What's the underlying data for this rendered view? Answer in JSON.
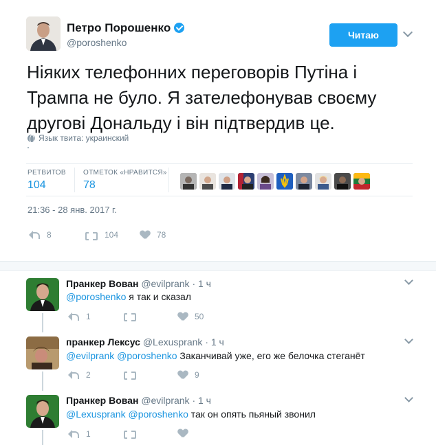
{
  "tweet": {
    "author_name": "Петро Порошенко",
    "author_handle": "@poroshenko",
    "follow_label": "Читаю",
    "text": "Ніяких телефонних переговорів Путіна і Трампа не було. Я зателефонував своєму другові Дональду і він підтвердив це.",
    "language_note": "Язык твита: украинский",
    "retweets_label": "РЕТВИТОВ",
    "retweets_value": "104",
    "likes_label": "ОТМЕТОК «НРАВИТСЯ»",
    "likes_value": "78",
    "timestamp": "21:36 - 28 янв. 2017 г.",
    "action_reply_count": "8",
    "action_retweet_count": "104",
    "action_like_count": "78",
    "verified": true
  },
  "replies": [
    {
      "name": "Пранкер Вован",
      "handle": "@evilprank",
      "time": "· 1 ч",
      "mention1": "@poroshenko",
      "mention2": "",
      "text": " я так и сказал",
      "reply_count": "1",
      "retweet_count": "",
      "like_count": "50"
    },
    {
      "name": "пранкер Лексус",
      "handle": "@Lexusprank",
      "time": "· 1 ч",
      "mention1": "@evilprank",
      "mention2": "@poroshenko",
      "text": " Заканчивай уже, его же белочка стеганёт",
      "reply_count": "2",
      "retweet_count": "",
      "like_count": "9"
    },
    {
      "name": "Пранкер Вован",
      "handle": "@evilprank",
      "time": "· 1 ч",
      "mention1": "@Lexusprank",
      "mention2": "@poroshenko",
      "text": " так он опять пьяный звонил",
      "reply_count": "1",
      "retweet_count": "",
      "like_count": ""
    }
  ],
  "colors": {
    "accent": "#1da1f2",
    "link": "#1b95e0",
    "muted": "#657786"
  }
}
